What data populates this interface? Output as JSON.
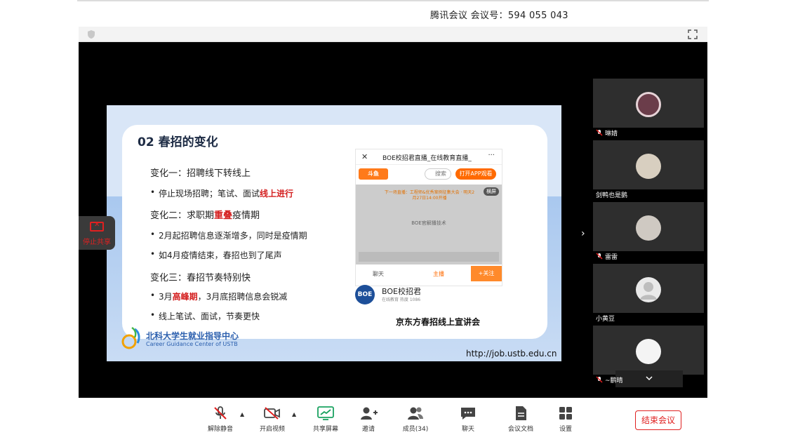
{
  "header": {
    "meeting_title": "腾讯会议 会议号：594 055 043"
  },
  "slide": {
    "heading": "02 春招的变化",
    "change1_title": "变化一：招聘线下转线上",
    "change1_bullet_prefix": "停止现场招聘；笔试、面试",
    "change1_bullet_highlight": "线上进行",
    "change2_title_prefix": "变化二：求职期",
    "change2_title_highlight": "重叠",
    "change2_title_suffix": "疫情期",
    "change2_bullet1": "2月起招聘信息逐渐增多，同时是疫情期",
    "change2_bullet2": "如4月疫情结束，春招也到了尾声",
    "change3_title": "变化三：春招节奏特别快",
    "change3_bullet1_prefix": "3月",
    "change3_bullet1_highlight": "高峰期",
    "change3_bullet1_suffix": "，3月底招聘信息会锐减",
    "change3_bullet2": "线上笔试、面试，节奏更快",
    "logo_cn": "北科大学生就业指导中心",
    "logo_en": "Career Guidance Center of USTB",
    "url": "http://job.ustb.edu.cn",
    "caption": "京东方春招线上宣讲会",
    "phone": {
      "close": "✕",
      "title": "BOE校招君直播_在线教育直播_",
      "more": "···",
      "brand": "斗鱼",
      "search": "搜索",
      "open_app": "打开APP观看",
      "video_notice": "下一场直播：工程师&优秀案例征集大会 · 明天2月27日14:00开播",
      "video_center": "BOE官解播技术",
      "live_tag": "横屏",
      "tab_chat": "聊天",
      "tab_host": "主播",
      "follow": "+关注",
      "boe_logo": "BOE",
      "boe_name": "BOE校招君",
      "boe_sub": "在线教育  热度 1086"
    }
  },
  "stop_share": {
    "label": "停止共享"
  },
  "participants": [
    {
      "name": "琳婧",
      "avatar_color": "#6b3d4a",
      "muted": true
    },
    {
      "name": "剑鸭也是鹅",
      "avatar_color": "#d8cfc0",
      "muted": false
    },
    {
      "name": "雷雷",
      "avatar_color": "#cfc9c2",
      "muted": true
    },
    {
      "name": "小黄豆",
      "avatar_color": "#e9e9e9",
      "muted": false
    },
    {
      "name": "~鹏晴",
      "avatar_color": "#f4f4f4",
      "muted": true
    }
  ],
  "toolbar": {
    "unmute": "解除静音",
    "start_video": "开启视频",
    "share_screen": "共享屏幕",
    "invite": "邀请",
    "members": "成员(34)",
    "chat": "聊天",
    "docs": "会议文档",
    "settings": "设置",
    "end_meeting": "结束会议"
  },
  "colors": {
    "danger": "#e02020",
    "accent_share": "#1aa260",
    "brand_orange": "#ff6a00"
  }
}
